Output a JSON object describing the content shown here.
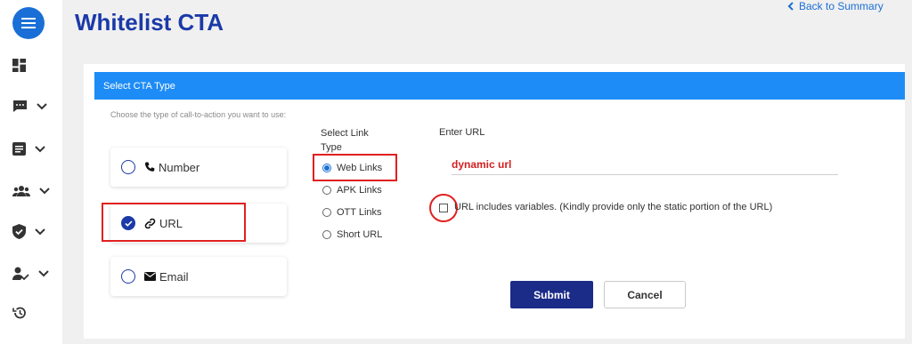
{
  "header": {
    "title": "Whitelist CTA",
    "back_label": "Back to Summary"
  },
  "sidebar": {
    "items": [
      {
        "icon": "dashboard-icon"
      },
      {
        "icon": "chat-icon"
      },
      {
        "icon": "document-icon"
      },
      {
        "icon": "group-icon"
      },
      {
        "icon": "shield-check-icon"
      },
      {
        "icon": "user-check-icon"
      },
      {
        "icon": "history-icon"
      }
    ]
  },
  "cta_panel": {
    "header": "Select CTA Type",
    "instruction": "Choose the type of call-to-action you want to use:",
    "options": [
      {
        "label": "Number",
        "icon": "phone-icon",
        "selected": false
      },
      {
        "label": "URL",
        "icon": "link-icon",
        "selected": true
      },
      {
        "label": "Email",
        "icon": "mail-icon",
        "selected": false
      }
    ]
  },
  "link_type": {
    "label": "Select Link Type",
    "options": [
      {
        "label": "Web Links",
        "selected": true
      },
      {
        "label": "APK Links",
        "selected": false
      },
      {
        "label": "OTT Links",
        "selected": false
      },
      {
        "label": "Short URL",
        "selected": false
      }
    ]
  },
  "url_field": {
    "label": "Enter URL",
    "value": "dynamic url"
  },
  "variables_checkbox": {
    "label": "URL includes variables. (Kindly provide only the static portion of the URL)",
    "checked": false
  },
  "actions": {
    "submit_label": "Submit",
    "cancel_label": "Cancel"
  },
  "colors": {
    "accent": "#1e8cf6",
    "title": "#1b3aa8",
    "submit": "#1b2b88",
    "annotation": "#e02020"
  }
}
